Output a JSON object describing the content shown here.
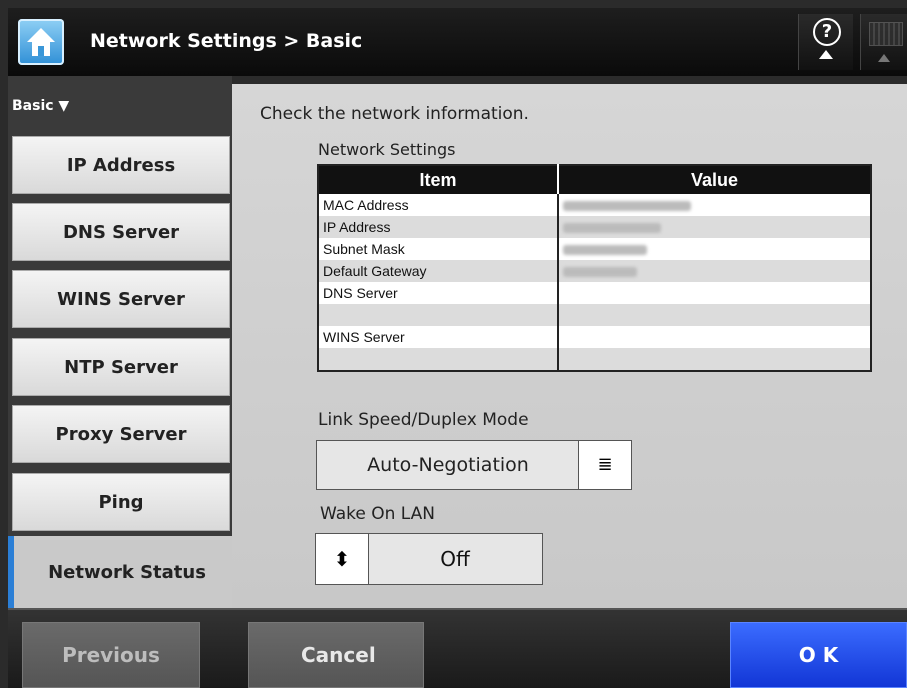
{
  "header": {
    "title": "Network Settings > Basic",
    "help_icon": "?"
  },
  "sidebar": {
    "section": "Basic ▼",
    "items": [
      {
        "label": "IP Address"
      },
      {
        "label": "DNS Server"
      },
      {
        "label": "WINS Server"
      },
      {
        "label": "NTP Server"
      },
      {
        "label": "Proxy Server"
      },
      {
        "label": "Ping"
      }
    ],
    "active": "Network Status",
    "accent": "#2b7fd6"
  },
  "main": {
    "intro": "Check the network information.",
    "network_settings_title": "Network Settings",
    "table": {
      "headers": [
        "Item",
        "Value"
      ],
      "rows": [
        {
          "item": "MAC Address",
          "value_hidden": true
        },
        {
          "item": "IP Address",
          "value_hidden": true
        },
        {
          "item": "Subnet Mask",
          "value_hidden": true
        },
        {
          "item": "Default Gateway",
          "value_hidden": true
        },
        {
          "item": "DNS Server",
          "value_hidden": false
        },
        {
          "item": "",
          "value_hidden": false
        },
        {
          "item": "WINS Server",
          "value_hidden": false
        },
        {
          "item": "",
          "value_hidden": false
        }
      ]
    },
    "link_speed_title": "Link Speed/Duplex Mode",
    "link_speed_value": "Auto-Negotiation",
    "wol_title": "Wake On LAN",
    "wol_value": "Off"
  },
  "footer": {
    "previous": "Previous",
    "cancel": "Cancel",
    "ok": "O K",
    "ok_color": "#1236d6"
  }
}
